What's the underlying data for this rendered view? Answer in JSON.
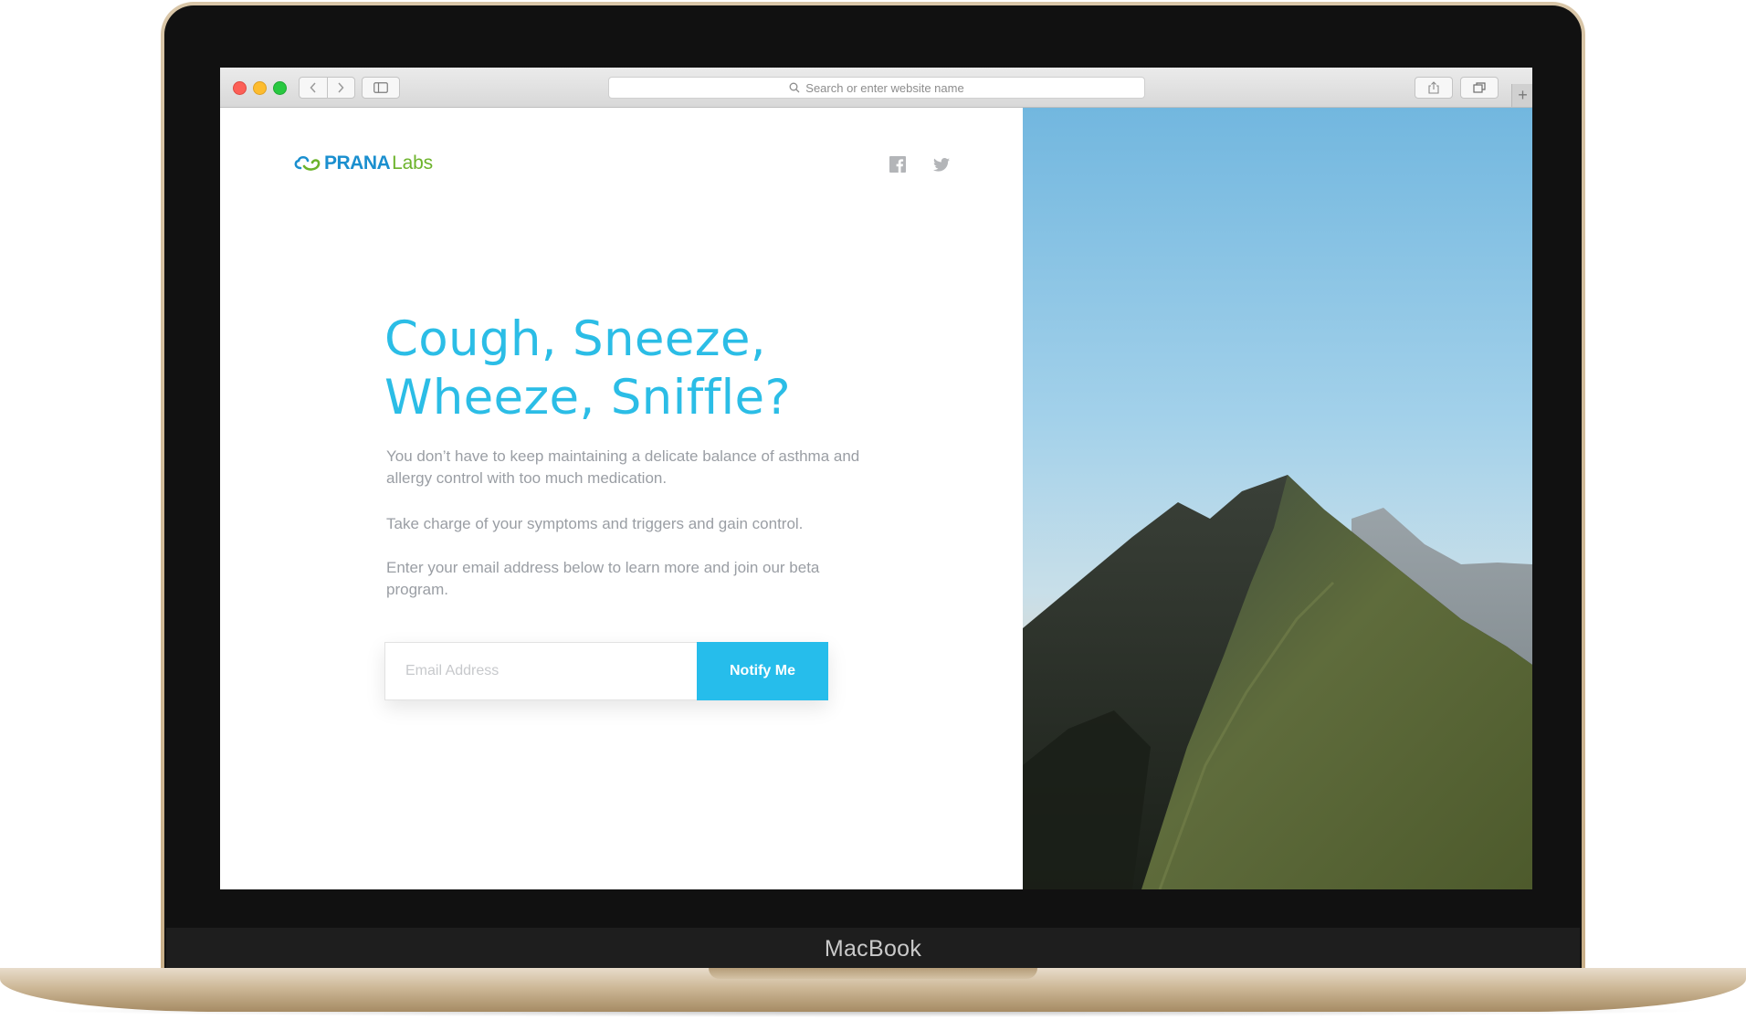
{
  "device": {
    "brand_label": "MacBook"
  },
  "browser": {
    "address_placeholder": "Search or enter website name",
    "new_tab_symbol": "+"
  },
  "header": {
    "logo_main": "PRANA",
    "logo_sub": "Labs",
    "social": [
      {
        "icon": "facebook-icon"
      },
      {
        "icon": "twitter-icon"
      }
    ]
  },
  "hero": {
    "headline_line1": "Cough, Sneeze,",
    "headline_line2": "Wheeze, Sniffle?",
    "paragraph1": "You don’t have to keep maintaining a delicate balance of asthma and allergy control with too much medication.",
    "paragraph2": "Take charge of your symptoms and triggers and gain control.",
    "paragraph3": "Enter your email address below to learn more and join our beta program."
  },
  "signup": {
    "email_placeholder": "Email Address",
    "button_label": "Notify Me"
  },
  "colors": {
    "accent": "#26bdeb",
    "headline": "#2bbde6",
    "body_text": "#9a9ea4",
    "logo_blue": "#1a8fcf",
    "logo_green": "#6cb32b",
    "laptop_gold": "#c9b08a"
  }
}
